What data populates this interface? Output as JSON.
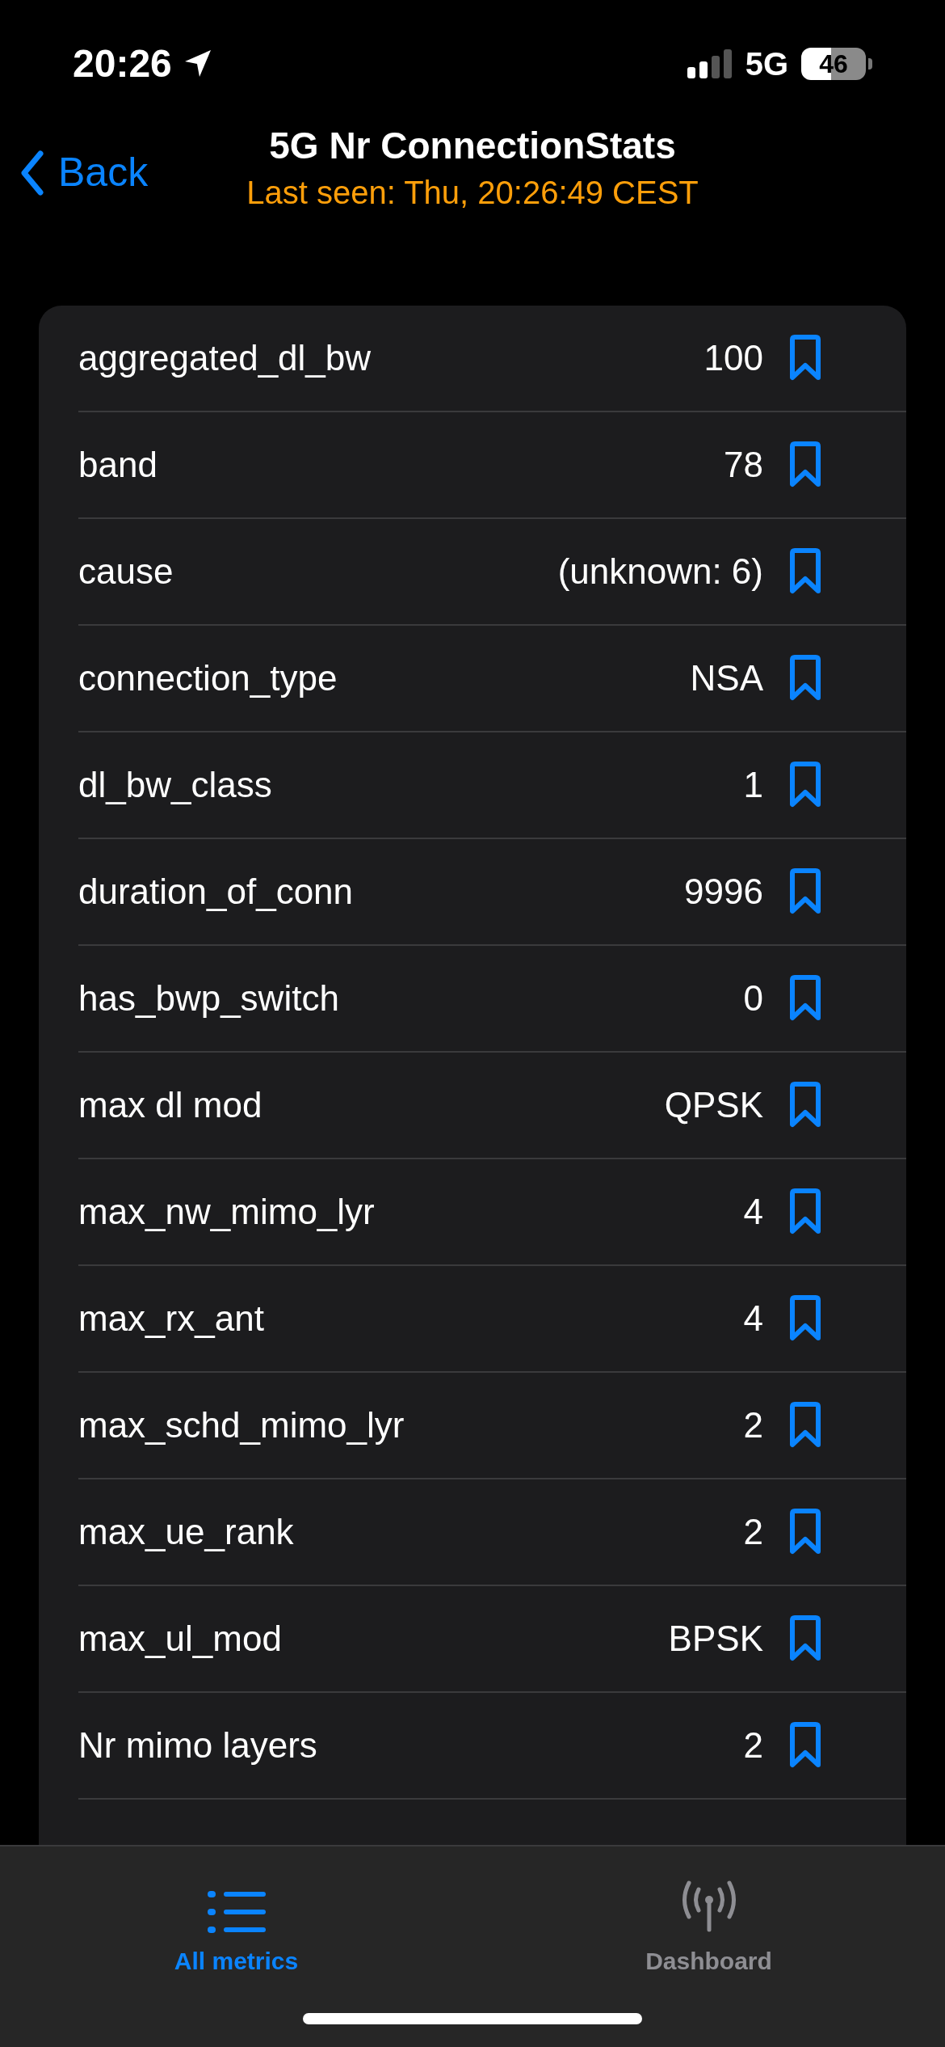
{
  "status_bar": {
    "time": "20:26",
    "network": "5G",
    "battery": "46"
  },
  "nav": {
    "back": "Back",
    "title": "5G Nr ConnectionStats",
    "subtitle": "Last seen: Thu, 20:26:49 CEST"
  },
  "metrics": [
    {
      "name": "aggregated_dl_bw",
      "value": "100",
      "bookmarked": false
    },
    {
      "name": "band",
      "value": "78",
      "bookmarked": false
    },
    {
      "name": "cause",
      "value": "(unknown: 6)",
      "bookmarked": false
    },
    {
      "name": "connection_type",
      "value": "NSA",
      "bookmarked": false
    },
    {
      "name": "dl_bw_class",
      "value": "1",
      "bookmarked": false
    },
    {
      "name": "duration_of_conn",
      "value": "9996",
      "bookmarked": false
    },
    {
      "name": "has_bwp_switch",
      "value": "0",
      "bookmarked": false
    },
    {
      "name": "max dl mod",
      "value": "QPSK",
      "bookmarked": false
    },
    {
      "name": "max_nw_mimo_lyr",
      "value": "4",
      "bookmarked": false
    },
    {
      "name": "max_rx_ant",
      "value": "4",
      "bookmarked": false
    },
    {
      "name": "max_schd_mimo_lyr",
      "value": "2",
      "bookmarked": false
    },
    {
      "name": "max_ue_rank",
      "value": "2",
      "bookmarked": false
    },
    {
      "name": "max_ul_mod",
      "value": "BPSK",
      "bookmarked": false
    },
    {
      "name": "Nr mimo layers",
      "value": "2",
      "bookmarked": false
    }
  ],
  "tabs": [
    {
      "label": "All metrics",
      "kind": "list",
      "selected": true
    },
    {
      "label": "Dashboard",
      "kind": "antenna",
      "selected": false
    }
  ]
}
